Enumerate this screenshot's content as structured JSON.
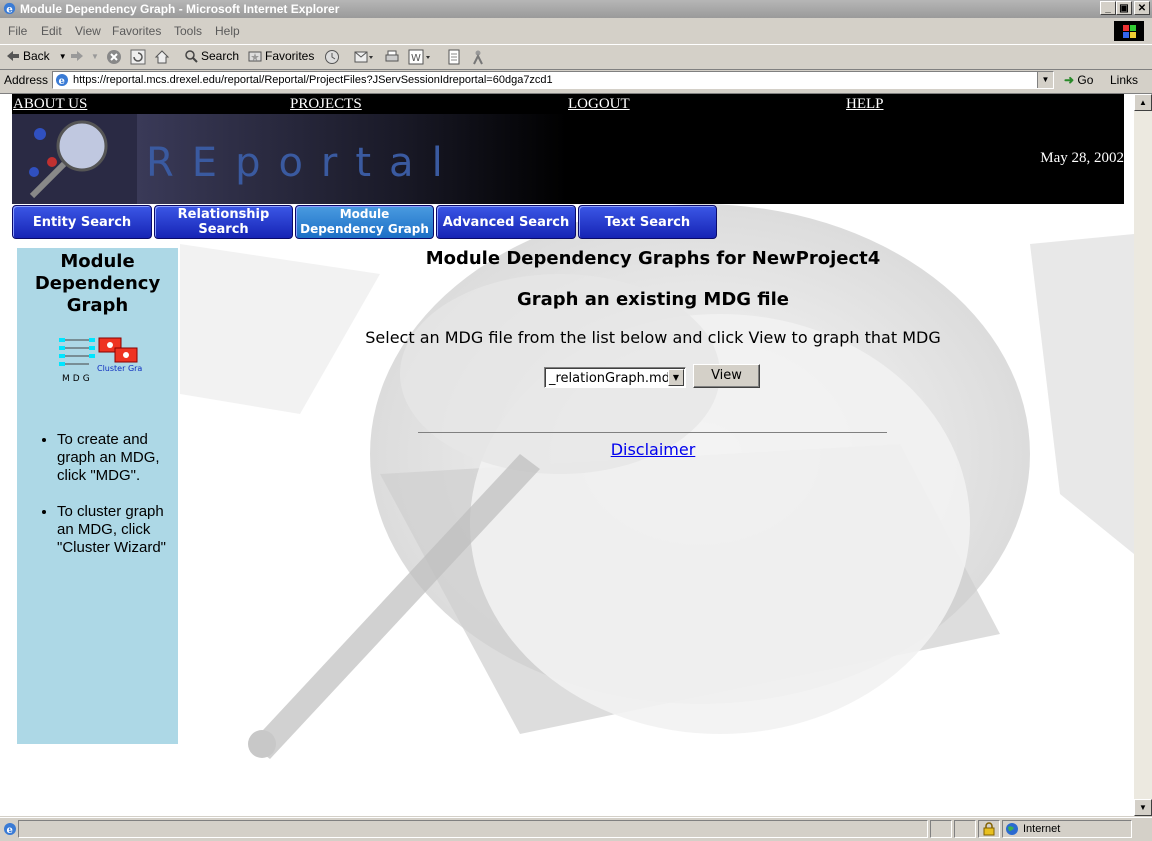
{
  "window": {
    "title": "Module Dependency Graph - Microsoft Internet Explorer",
    "controls": [
      "_",
      "▣",
      "✕"
    ]
  },
  "menu": [
    "File",
    "Edit",
    "View",
    "Favorites",
    "Tools",
    "Help"
  ],
  "toolbar": {
    "back": "Back",
    "search": "Search",
    "favorites": "Favorites"
  },
  "address": {
    "label": "Address",
    "url": "https://reportal.mcs.drexel.edu/reportal/Reportal/ProjectFiles?JServSessionIdreportal=60dga7zcd1",
    "go": "Go",
    "links": "Links"
  },
  "site": {
    "nav": [
      "ABOUT US",
      "PROJECTS",
      "LOGOUT",
      "HELP"
    ],
    "logo_text": "REportal",
    "date": "May 28, 2002",
    "tabs": [
      {
        "label": "Entity Search"
      },
      {
        "label": "Relationship Search"
      },
      {
        "label": "Module Dependency Graph"
      },
      {
        "label": "Advanced Search"
      },
      {
        "label": "Text Search"
      }
    ]
  },
  "sidebar": {
    "title": "Module Dependency Graph",
    "icon_mdg": "MDG",
    "icon_cluster": "Cluster Graph",
    "tips": [
      "To create and graph an MDG, click \"MDG\".",
      "To cluster graph an MDG, click \"Cluster Wizard\""
    ]
  },
  "main": {
    "heading": "Module Dependency Graphs for NewProject4",
    "subheading": "Graph an existing MDG file",
    "instruction": "Select an MDG file from the list below and click View to graph that MDG",
    "select_value": "_relationGraph.mdg",
    "view_button": "View",
    "disclaimer": "Disclaimer"
  },
  "status": {
    "zone": "Internet"
  },
  "colors": {
    "sidebar_bg": "#add8e6",
    "tab_blue": "#1624b5",
    "tab_active": "#1c6fc6",
    "link_blue": "#0000ee"
  }
}
